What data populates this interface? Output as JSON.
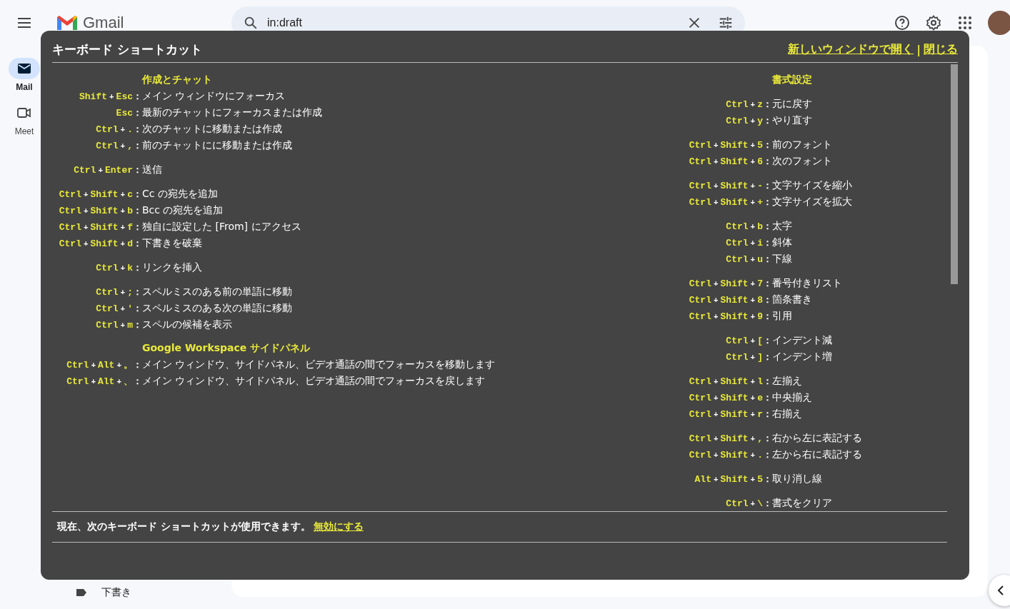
{
  "app": {
    "logo_text": "Gmail",
    "search": {
      "value": "in:draft"
    },
    "rail": [
      {
        "kind": "mail",
        "label": "Mail",
        "selected": true
      },
      {
        "kind": "meet",
        "label": "Meet",
        "selected": false
      }
    ],
    "sidebar_item": {
      "label": "下書き"
    }
  },
  "shortcuts_panel": {
    "title": "キーボード ショートカット",
    "links": [
      "新しいウィンドウで開く",
      "閉じる"
    ],
    "link_separator": "|",
    "columns": [
      {
        "sections": [
          {
            "title": "作成とチャット",
            "groups": [
              [
                {
                  "keys": [
                    "Shift",
                    "+",
                    "Esc"
                  ],
                  "colon": "：",
                  "action": "メイン ウィンドウにフォーカス"
                },
                {
                  "keys": [
                    "Esc"
                  ],
                  "colon": "：",
                  "action": "最新のチャットにフォーカスまたは作成"
                },
                {
                  "keys": [
                    "Ctrl",
                    "+",
                    "."
                  ],
                  "colon": "：",
                  "action": "次のチャットに移動または作成"
                },
                {
                  "keys": [
                    "Ctrl",
                    "+",
                    ","
                  ],
                  "colon": "：",
                  "action": "前のチャットにに移動または作成"
                }
              ],
              [
                {
                  "keys": [
                    "Ctrl",
                    "+",
                    "Enter"
                  ],
                  "colon": "：",
                  "action": "送信"
                }
              ],
              [
                {
                  "keys": [
                    "Ctrl",
                    "+",
                    "Shift",
                    "+",
                    "c"
                  ],
                  "colon": "：",
                  "action": "Cc の宛先を追加"
                },
                {
                  "keys": [
                    "Ctrl",
                    "+",
                    "Shift",
                    "+",
                    "b"
                  ],
                  "colon": "：",
                  "action": "Bcc の宛先を追加"
                },
                {
                  "keys": [
                    "Ctrl",
                    "+",
                    "Shift",
                    "+",
                    "f"
                  ],
                  "colon": "：",
                  "action": "独自に設定した [From] にアクセス"
                },
                {
                  "keys": [
                    "Ctrl",
                    "+",
                    "Shift",
                    "+",
                    "d"
                  ],
                  "colon": "：",
                  "action": "下書きを破棄"
                }
              ],
              [
                {
                  "keys": [
                    "Ctrl",
                    "+",
                    "k"
                  ],
                  "colon": "：",
                  "action": "リンクを挿入"
                }
              ],
              [
                {
                  "keys": [
                    "Ctrl",
                    "+",
                    ";"
                  ],
                  "colon": "：",
                  "action": "スペルミスのある前の単語に移動"
                },
                {
                  "keys": [
                    "Ctrl",
                    "+",
                    "'"
                  ],
                  "colon": "：",
                  "action": "スペルミスのある次の単語に移動"
                },
                {
                  "keys": [
                    "Ctrl",
                    "+",
                    "m"
                  ],
                  "colon": "：",
                  "action": "スペルの候補を表示"
                }
              ]
            ]
          },
          {
            "title": "Google Workspace サイドパネル",
            "groups": [
              [
                {
                  "keys": [
                    "Ctrl",
                    "+",
                    "Alt",
                    "+",
                    "。"
                  ],
                  "colon": "：",
                  "action": "メイン ウィンドウ、サイドパネル、ビデオ通話の間でフォーカスを移動します"
                },
                {
                  "keys": [
                    "Ctrl",
                    "+",
                    "Alt",
                    "+",
                    "、"
                  ],
                  "colon": "：",
                  "action": "メイン ウィンドウ、サイドパネル、ビデオ通話の間でフォーカスを戻します"
                }
              ]
            ]
          }
        ]
      },
      {
        "sections": [
          {
            "title": "書式設定",
            "groups": [
              [
                {
                  "keys": [
                    "Ctrl",
                    "+",
                    "z"
                  ],
                  "colon": "：",
                  "action": "元に戻す"
                },
                {
                  "keys": [
                    "Ctrl",
                    "+",
                    "y"
                  ],
                  "colon": "：",
                  "action": "やり直す"
                }
              ],
              [
                {
                  "keys": [
                    "Ctrl",
                    "+",
                    "Shift",
                    "+",
                    "5"
                  ],
                  "colon": "：",
                  "action": "前のフォント"
                },
                {
                  "keys": [
                    "Ctrl",
                    "+",
                    "Shift",
                    "+",
                    "6"
                  ],
                  "colon": "：",
                  "action": "次のフォント"
                }
              ],
              [
                {
                  "keys": [
                    "Ctrl",
                    "+",
                    "Shift",
                    "+",
                    "-"
                  ],
                  "colon": "：",
                  "action": "文字サイズを縮小"
                },
                {
                  "keys": [
                    "Ctrl",
                    "+",
                    "Shift",
                    "+",
                    "+"
                  ],
                  "colon": "：",
                  "action": "文字サイズを拡大"
                }
              ],
              [
                {
                  "keys": [
                    "Ctrl",
                    "+",
                    "b"
                  ],
                  "colon": "：",
                  "action": "太字"
                },
                {
                  "keys": [
                    "Ctrl",
                    "+",
                    "i"
                  ],
                  "colon": "：",
                  "action": "斜体"
                },
                {
                  "keys": [
                    "Ctrl",
                    "+",
                    "u"
                  ],
                  "colon": "：",
                  "action": "下線"
                }
              ],
              [
                {
                  "keys": [
                    "Ctrl",
                    "+",
                    "Shift",
                    "+",
                    "7"
                  ],
                  "colon": "：",
                  "action": "番号付きリスト"
                },
                {
                  "keys": [
                    "Ctrl",
                    "+",
                    "Shift",
                    "+",
                    "8"
                  ],
                  "colon": "：",
                  "action": "箇条書き"
                },
                {
                  "keys": [
                    "Ctrl",
                    "+",
                    "Shift",
                    "+",
                    "9"
                  ],
                  "colon": "：",
                  "action": "引用"
                }
              ],
              [
                {
                  "keys": [
                    "Ctrl",
                    "+",
                    "["
                  ],
                  "colon": "：",
                  "action": "インデント減"
                },
                {
                  "keys": [
                    "Ctrl",
                    "+",
                    "]"
                  ],
                  "colon": "：",
                  "action": "インデント増"
                }
              ],
              [
                {
                  "keys": [
                    "Ctrl",
                    "+",
                    "Shift",
                    "+",
                    "l"
                  ],
                  "colon": "：",
                  "action": "左揃え"
                },
                {
                  "keys": [
                    "Ctrl",
                    "+",
                    "Shift",
                    "+",
                    "e"
                  ],
                  "colon": "：",
                  "action": "中央揃え"
                },
                {
                  "keys": [
                    "Ctrl",
                    "+",
                    "Shift",
                    "+",
                    "r"
                  ],
                  "colon": "：",
                  "action": "右揃え"
                }
              ],
              [
                {
                  "keys": [
                    "Ctrl",
                    "+",
                    "Shift",
                    "+",
                    ","
                  ],
                  "colon": "：",
                  "action": "右から左に表記する"
                },
                {
                  "keys": [
                    "Ctrl",
                    "+",
                    "Shift",
                    "+",
                    "."
                  ],
                  "colon": "：",
                  "action": "左から右に表記する"
                }
              ],
              [
                {
                  "keys": [
                    "Alt",
                    "+",
                    "Shift",
                    "+",
                    "5"
                  ],
                  "colon": "：",
                  "action": "取り消し線"
                }
              ],
              [
                {
                  "keys": [
                    "Ctrl",
                    "+",
                    "\\"
                  ],
                  "colon": "：",
                  "action": "書式をクリア"
                }
              ]
            ]
          }
        ]
      }
    ],
    "status_text": "現在、次のキーボード ショートカットが使用できます。",
    "status_link": "無効にする"
  }
}
